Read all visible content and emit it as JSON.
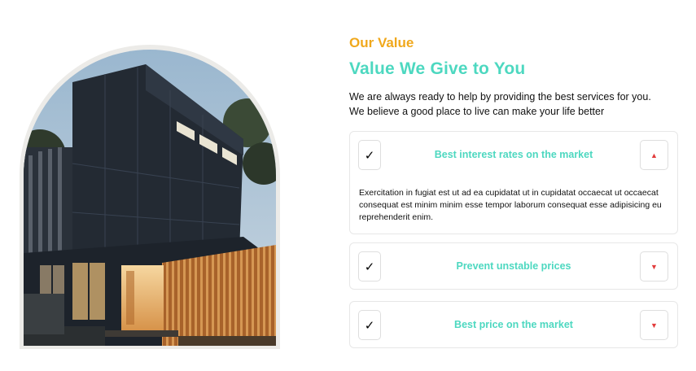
{
  "section": {
    "eyebrow": "Our Value",
    "headline": "Value We Give to You",
    "intro": [
      "We are always ready to help by providing the best services for you.",
      "We believe a good place to live can make your life better"
    ]
  },
  "accordion": [
    {
      "check": "✓",
      "title": "Best interest rates on the market",
      "toggle": "▲",
      "expanded": true,
      "body": "Exercitation in fugiat est ut ad ea cupidatat ut in cupidatat occaecat ut occaecat consequat est minim minim esse tempor laborum consequat esse adipisicing eu reprehenderit enim."
    },
    {
      "check": "✓",
      "title": "Prevent unstable prices",
      "toggle": "▼",
      "expanded": false
    },
    {
      "check": "✓",
      "title": "Best price on the market",
      "toggle": "▼",
      "expanded": false
    }
  ],
  "colors": {
    "eyebrow": "#f0a81c",
    "accent": "#4dd8c0",
    "toggle_arrow": "#e23b3b",
    "arch_frame": "#ecebe8"
  },
  "image": {
    "subject": "modern dark-clad house at dusk with timber slat facade"
  }
}
